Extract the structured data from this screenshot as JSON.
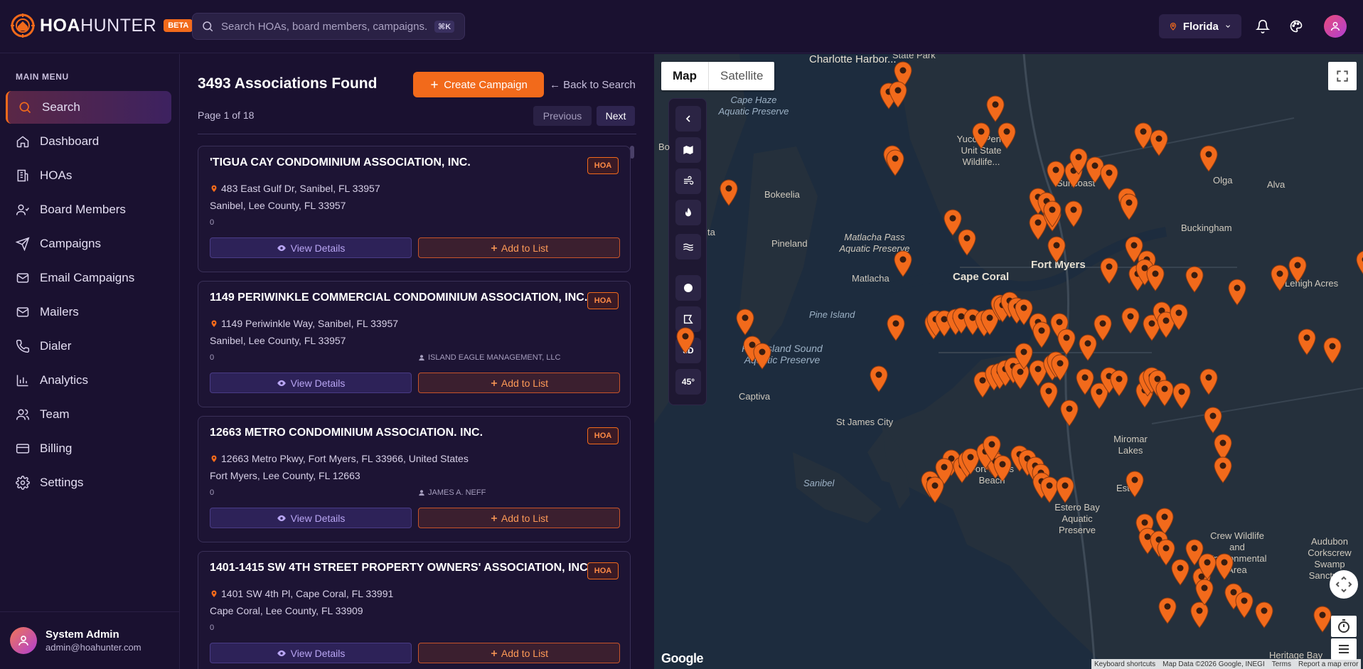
{
  "app": {
    "brand_main": "HOA",
    "brand_thin": "HUNTER",
    "beta_label": "BETA"
  },
  "search": {
    "placeholder": "Search HOAs, board members, campaigns...",
    "shortcut": "⌘K"
  },
  "header": {
    "state": "Florida"
  },
  "sidebar": {
    "title": "MAIN MENU",
    "items": [
      {
        "label": "Search",
        "icon": "search-icon",
        "active": true
      },
      {
        "label": "Dashboard",
        "icon": "home-icon"
      },
      {
        "label": "HOAs",
        "icon": "building-icon"
      },
      {
        "label": "Board Members",
        "icon": "users-icon"
      },
      {
        "label": "Campaigns",
        "icon": "send-icon"
      },
      {
        "label": "Email Campaigns",
        "icon": "mail-icon"
      },
      {
        "label": "Mailers",
        "icon": "envelope-icon"
      },
      {
        "label": "Dialer",
        "icon": "phone-icon"
      },
      {
        "label": "Analytics",
        "icon": "chart-icon"
      },
      {
        "label": "Team",
        "icon": "team-icon"
      },
      {
        "label": "Billing",
        "icon": "card-icon"
      },
      {
        "label": "Settings",
        "icon": "gear-icon"
      }
    ],
    "user": {
      "name": "System Admin",
      "email": "admin@hoahunter.com"
    }
  },
  "results": {
    "title": "3493 Associations Found",
    "create_label": "Create Campaign",
    "back_label": "← Back to Search",
    "page_info": "Page 1 of 18",
    "prev_label": "Previous",
    "next_label": "Next",
    "view_label": "View Details",
    "add_label": "Add to List",
    "cards": [
      {
        "name": "'TIGUA CAY CONDOMINIUM ASSOCIATION, INC.",
        "type": "HOA",
        "address": "483 East Gulf Dr, Sanibel, FL 33957",
        "city": "Sanibel, Lee County, FL 33957",
        "count": "0",
        "management": ""
      },
      {
        "name": "1149 PERIWINKLE COMMERCIAL CONDOMINIUM ASSOCIATION, INC.",
        "type": "HOA",
        "address": "1149 Periwinkle Way, Sanibel, FL 33957",
        "city": "Sanibel, Lee County, FL 33957",
        "count": "0",
        "management": "ISLAND EAGLE MANAGEMENT, LLC"
      },
      {
        "name": "12663 METRO CONDOMINIUM ASSOCIATION. INC.",
        "type": "HOA",
        "address": "12663 Metro Pkwy, Fort Myers, FL 33966, United States",
        "city": "Fort Myers, Lee County, FL 12663",
        "count": "0",
        "management": "JAMES A. NEFF"
      },
      {
        "name": "1401-1415 SW 4TH STREET PROPERTY OWNERS' ASSOCIATION, INC.",
        "type": "HOA",
        "address": "1401 SW 4th Pl, Cape Coral, FL 33991",
        "city": "Cape Coral, Lee County, FL 33909",
        "count": "0",
        "management": ""
      }
    ]
  },
  "map": {
    "tab_map": "Map",
    "tab_satellite": "Satellite",
    "tool_3d": "3D",
    "tool_45": "45°",
    "labels": [
      {
        "text": "Charlotte Harbor...",
        "kind": "city"
      },
      {
        "text": "State Park",
        "kind": "land"
      },
      {
        "text": "Cape Haze Aquatic Preserve",
        "kind": "water"
      },
      {
        "text": "Yucca Pens Unit State Wildlife...",
        "kind": "land"
      },
      {
        "text": "Bokeelia",
        "kind": "land"
      },
      {
        "text": "Pineland",
        "kind": "land"
      },
      {
        "text": "Matlacha Pass Aquatic Preserve",
        "kind": "land"
      },
      {
        "text": "Matlacha",
        "kind": "land"
      },
      {
        "text": "Cape Coral",
        "kind": "city"
      },
      {
        "text": "Fort Myers",
        "kind": "city"
      },
      {
        "text": "Olga",
        "kind": "land"
      },
      {
        "text": "Alva",
        "kind": "land"
      },
      {
        "text": "Buckingham",
        "kind": "land"
      },
      {
        "text": "Lehigh Acres",
        "kind": "land"
      },
      {
        "text": "Pine Island",
        "kind": "water"
      },
      {
        "text": "Pine Island Sound Aquatic Preserve",
        "kind": "water"
      },
      {
        "text": "Captiva",
        "kind": "land"
      },
      {
        "text": "St James City",
        "kind": "land"
      },
      {
        "text": "Sanibel",
        "kind": "water"
      },
      {
        "text": "Fort Myers Beach",
        "kind": "land"
      },
      {
        "text": "Miromar Lakes",
        "kind": "land"
      },
      {
        "text": "Estero Bay Aquatic Preserve",
        "kind": "land"
      },
      {
        "text": "Crew Wildlife and Environmental Area",
        "kind": "land"
      },
      {
        "text": "Audubon Corkscrew Swamp Sanctuary",
        "kind": "land"
      },
      {
        "text": "Heritage Bay",
        "kind": "land"
      },
      {
        "text": "Suncoast",
        "kind": "land"
      },
      {
        "text": "Bo",
        "kind": "land"
      },
      {
        "text": "ta",
        "kind": "land"
      },
      {
        "text": "Este",
        "kind": "land"
      }
    ],
    "footer": {
      "shortcuts": "Keyboard shortcuts",
      "data": "Map Data ©2026 Google, INEGI",
      "terms": "Terms",
      "report": "Report a map error"
    },
    "google": "Google",
    "pin_color": "#f26a1b"
  }
}
